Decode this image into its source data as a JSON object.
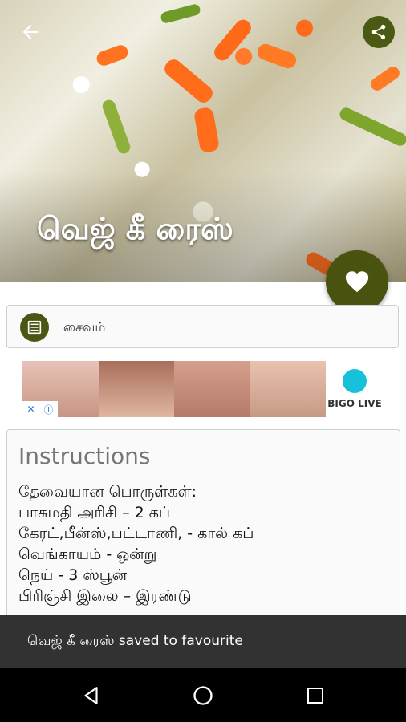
{
  "recipe": {
    "title": "வெஜ் கீ ரைஸ்",
    "category": "சைவம்"
  },
  "ad": {
    "brand": "BIGO LIVE",
    "close_label": "✕",
    "info_label": "ⓘ"
  },
  "instructions": {
    "heading": "Instructions",
    "lines": [
      "தேவையான பொருள்கள்:",
      "பாசுமதி அரிசி – 2 கப்",
      "கேரட்,பீன்ஸ்,பட்டாணி, - கால் கப்",
      "வெங்காயம் - ஒன்று",
      "நெய் - 3 ஸ்பூன்",
      "பிரிஞ்சி இலை – இரண்டு"
    ]
  },
  "snackbar": {
    "message": "வெஜ் கீ ரைஸ்  saved to favourite"
  },
  "colors": {
    "accent": "#4a520f",
    "snackbar_bg": "#323232",
    "nav_bg": "#000000"
  }
}
